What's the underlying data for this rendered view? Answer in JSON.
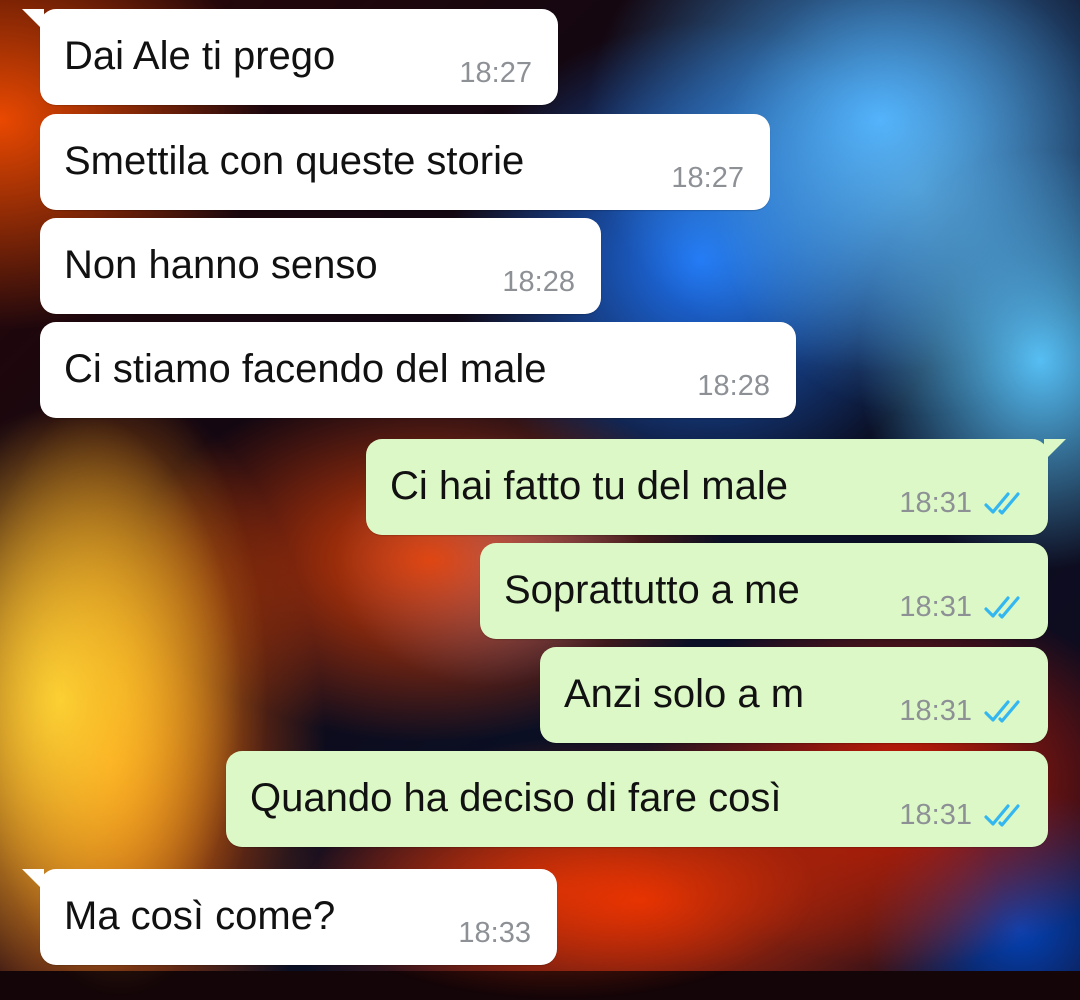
{
  "conversation": {
    "messages": [
      {
        "direction": "incoming",
        "text": "Dai Ale ti prego",
        "time": "18:27"
      },
      {
        "direction": "incoming",
        "text": "Smettila con queste storie",
        "time": "18:27"
      },
      {
        "direction": "incoming",
        "text": "Non hanno senso",
        "time": "18:28"
      },
      {
        "direction": "incoming",
        "text": "Ci stiamo facendo del male",
        "time": "18:28"
      },
      {
        "direction": "outgoing",
        "text": "Ci hai fatto tu del male",
        "time": "18:31",
        "status_icon": "double-check-read-icon"
      },
      {
        "direction": "outgoing",
        "text": "Soprattutto a me",
        "time": "18:31",
        "status_icon": "double-check-read-icon"
      },
      {
        "direction": "outgoing",
        "text": "Anzi solo a m",
        "time": "18:31",
        "status_icon": "double-check-read-icon"
      },
      {
        "direction": "outgoing",
        "text": "Quando ha deciso di fare così",
        "time": "18:31",
        "status_icon": "double-check-read-icon"
      },
      {
        "direction": "incoming",
        "text": "Ma così come?",
        "time": "18:33"
      }
    ]
  },
  "colors": {
    "incoming_bubble": "#ffffff",
    "outgoing_bubble": "#dcf8c6",
    "timestamp": "#8d9196",
    "read_receipt": "#34b7f1"
  }
}
